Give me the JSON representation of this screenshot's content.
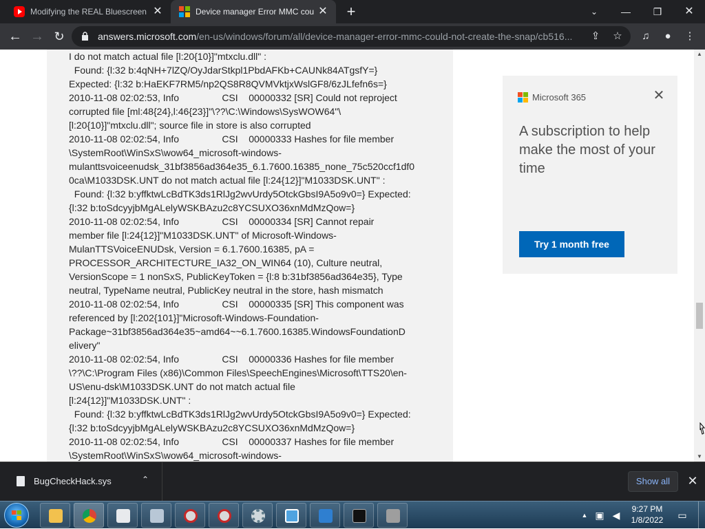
{
  "browser": {
    "tabs": [
      {
        "title": "Modifying the REAL Bluescreen in",
        "favicon": "youtube-icon",
        "active": false
      },
      {
        "title": "Device manager Error MMC coul",
        "favicon": "microsoft-icon",
        "active": true
      }
    ],
    "new_tab": "+",
    "url_host": "answers.microsoft.com",
    "url_path": "/en-us/windows/forum/all/device-manager-error-mmc-could-not-create-the-snap/cb516..."
  },
  "log_lines": [
    "I do not match actual file [l:20{10}]\"mtxclu.dll\" :",
    "  Found: {l:32 b:4qNH+7lZQ/OyJdarStkpl1PbdAFKb+CAUNk84ATgsfY=}",
    "Expected: {l:32 b:HaEKF7RM5/np2QS8R8QVMVktjxWslGF8/6zJLfefn6s=}",
    "2010-11-08 02:02:53, Info                CSI    00000332 [SR] Could not reproject",
    "corrupted file [ml:48{24},l:46{23}]\"\\??\\C:\\Windows\\SysWOW64\"\\",
    "[l:20{10}]\"mtxclu.dll\"; source file in store is also corrupted",
    "2010-11-08 02:02:54, Info                CSI    00000333 Hashes for file member",
    "\\SystemRoot\\WinSxS\\wow64_microsoft-windows-",
    "mulanttsvoiceenudsk_31bf3856ad364e35_6.1.7600.16385_none_75c520ccf1df0",
    "0ca\\M1033DSK.UNT do not match actual file [l:24{12}]\"M1033DSK.UNT\" :",
    "  Found: {l:32 b:yffktwLcBdTK3ds1RlJg2wvUrdy5OtckGbsI9A5o9v0=} Expected:",
    "{l:32 b:toSdcyyjbMgALelyWSKBAzu2c8YCSUXO36xnMdMzQow=}",
    "2010-11-08 02:02:54, Info                CSI    00000334 [SR] Cannot repair",
    "member file [l:24{12}]\"M1033DSK.UNT\" of Microsoft-Windows-",
    "MulanTTSVoiceENUDsk, Version = 6.1.7600.16385, pA =",
    "PROCESSOR_ARCHITECTURE_IA32_ON_WIN64 (10), Culture neutral,",
    "VersionScope = 1 nonSxS, PublicKeyToken = {l:8 b:31bf3856ad364e35}, Type",
    "neutral, TypeName neutral, PublicKey neutral in the store, hash mismatch",
    "2010-11-08 02:02:54, Info                CSI    00000335 [SR] This component was",
    "referenced by [l:202{101}]\"Microsoft-Windows-Foundation-",
    "Package~31bf3856ad364e35~amd64~~6.1.7600.16385.WindowsFoundationD",
    "elivery\"",
    "2010-11-08 02:02:54, Info                CSI    00000336 Hashes for file member",
    "\\??\\C:\\Program Files (x86)\\Common Files\\SpeechEngines\\Microsoft\\TTS20\\en-",
    "US\\enu-dsk\\M1033DSK.UNT do not match actual file",
    "[l:24{12}]\"M1033DSK.UNT\" :",
    "  Found: {l:32 b:yffktwLcBdTK3ds1RlJg2wvUrdy5OtckGbsI9A5o9v0=} Expected:",
    "{l:32 b:toSdcyyjbMgALelyWSKBAzu2c8YCSUXO36xnMdMzQow=}",
    "2010-11-08 02:02:54, Info                CSI    00000337 Hashes for file member",
    "\\SystemRoot\\WinSxS\\wow64_microsoft-windows-"
  ],
  "ad": {
    "brand": "Microsoft 365",
    "headline": "A subscription to help make the most of your time",
    "cta": "Try 1 month free",
    "accent": "#0067b8"
  },
  "downloads": {
    "file_name": "BugCheckHack.sys",
    "show_all": "Show all"
  },
  "taskbar": {
    "apps": [
      "file-explorer-icon",
      "chrome-icon",
      "store-icon",
      "app-icon",
      "blocked-app-icon",
      "blocked-app-icon",
      "settings-icon",
      "window-icon",
      "app-icon",
      "terminal-icon",
      "network-app-icon"
    ],
    "time": "9:27 PM",
    "date": "1/8/2022"
  }
}
